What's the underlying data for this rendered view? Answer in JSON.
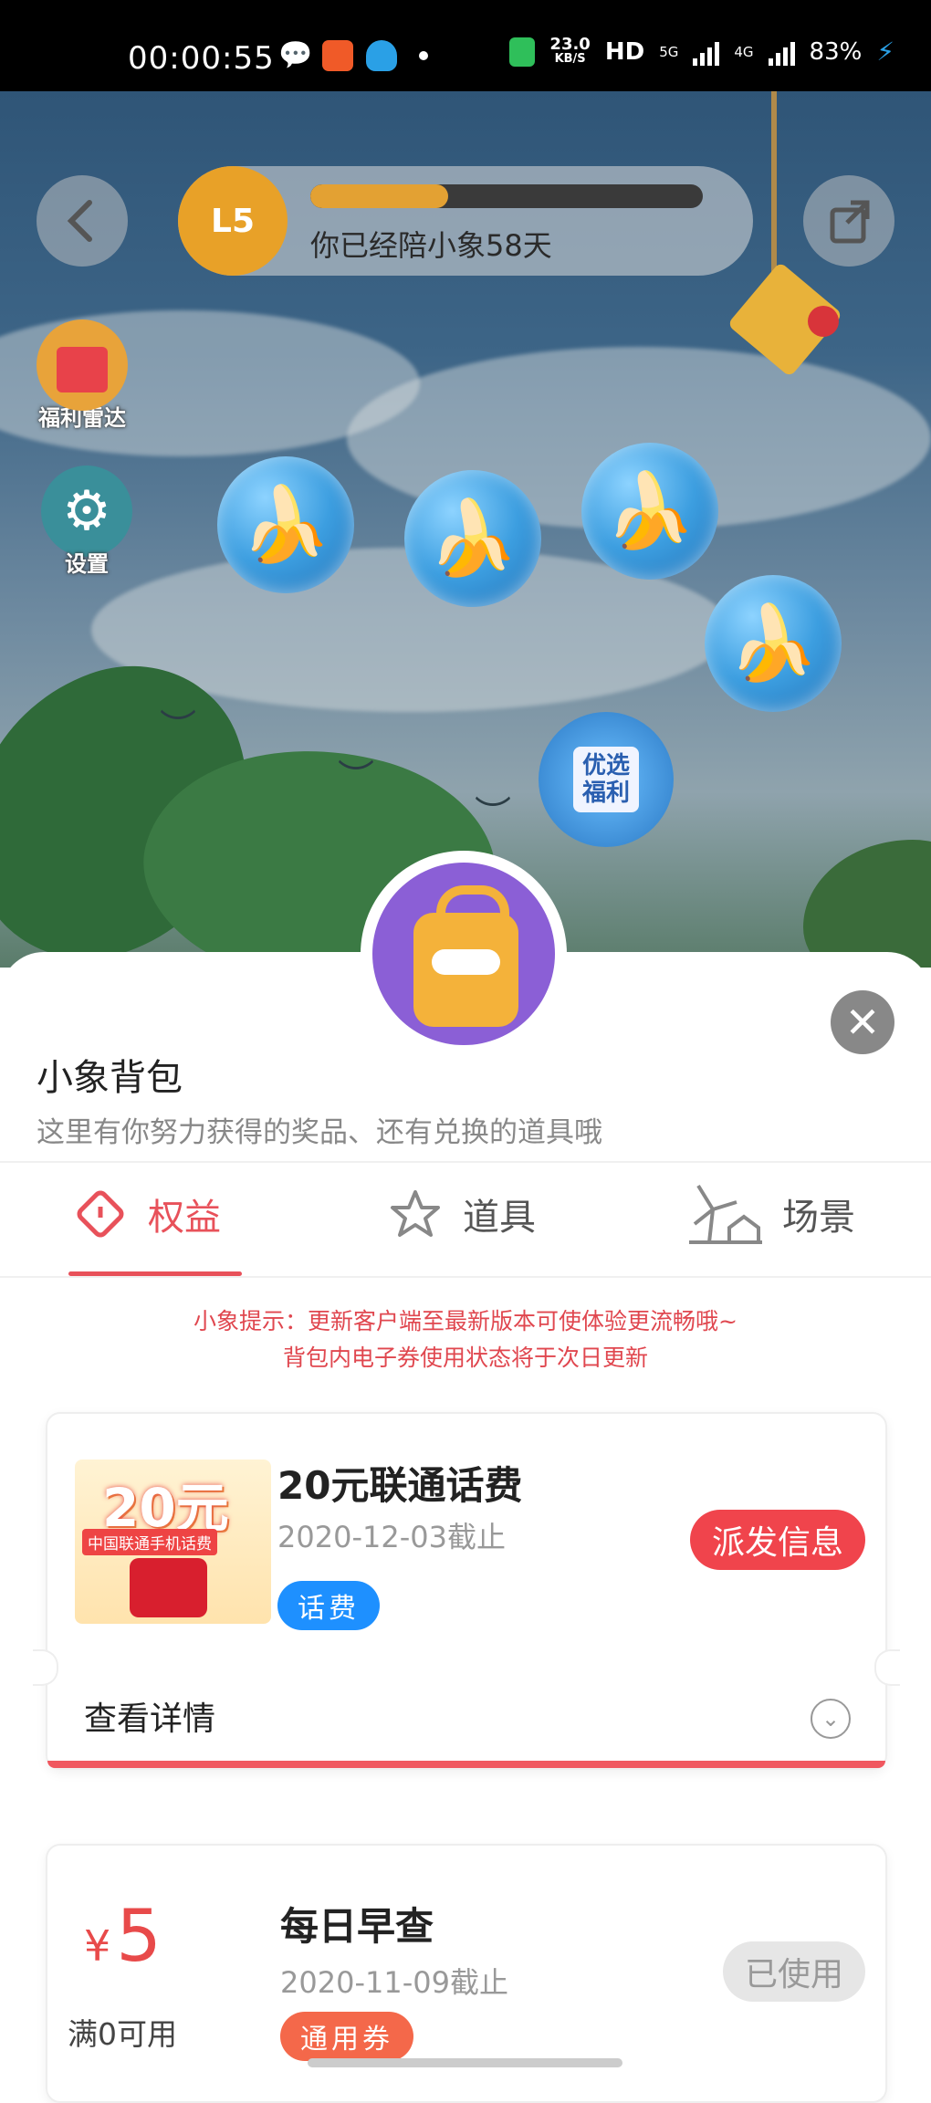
{
  "status_bar": {
    "time": "00:00:55",
    "net_speed": "23.0",
    "net_unit": "KB/S",
    "hd": "HD",
    "sig1": "5G",
    "sig2": "4G",
    "battery": "83%"
  },
  "game": {
    "level": "L5",
    "level_progress": 0.35,
    "companion_text": "你已经陪小象58天",
    "welfare_radar_label": "福利雷达",
    "settings_label": "设置",
    "promo_label": "优选福利"
  },
  "sheet": {
    "title": "小象背包",
    "subtitle": "这里有你努力获得的奖品、还有兑换的道具哦",
    "tabs": [
      {
        "label": "权益",
        "icon": "ticket-icon",
        "active": true
      },
      {
        "label": "道具",
        "icon": "star-icon",
        "active": false
      },
      {
        "label": "场景",
        "icon": "windmill-icon",
        "active": false
      }
    ],
    "notice_line1": "小象提示：更新客户端至最新版本可使体验更流畅哦~",
    "notice_line2": "背包内电子券使用状态将于次日更新"
  },
  "cards": [
    {
      "thumb_amount": "20元",
      "thumb_caption": "中国联通手机话费",
      "name": "20元联通话费",
      "deadline": "2020-12-03截止",
      "tag": "话费",
      "tag_color": "#1e90ff",
      "action": "派发信息",
      "action_bg": "#f0444c",
      "details": "查看详情"
    },
    {
      "currency": "¥",
      "value": "5",
      "min_use": "满0可用",
      "name": "每日早查",
      "deadline": "2020-11-09截止",
      "tag": "通用券",
      "tag_color": "#f4684a",
      "action": "已使用",
      "action_bg": "#e6e6e6"
    }
  ],
  "colors": {
    "accent": "#e8515a",
    "blue_tag": "#1e90ff"
  }
}
